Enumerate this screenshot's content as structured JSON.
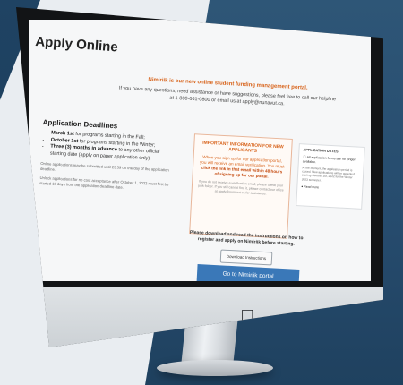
{
  "page": {
    "title": "Apply Online",
    "notice_headline": "Nimiriik is our new online student funding management portal.",
    "notice_body": "If you have any questions, need assistance or have suggestions, please feel free to call our helpline at 1-800-661-0800 or email us at apply@nunavut.ca."
  },
  "deadlines": {
    "heading": "Application Deadlines",
    "items": [
      {
        "bold": "March 1st",
        "rest": " for programs starting in the Fall;"
      },
      {
        "bold": "October 1st",
        "rest": " for programs starting in the Winter;"
      },
      {
        "bold": "Three (3) months in advance",
        "rest": " to any other official starting date (apply on paper application only)."
      }
    ],
    "note1": "Online applications may be submitted until 23:59 on the day of the application deadline.",
    "note2": "Unlock applications for no cost acceptance after October 1, 2022 must first be started 10 days from the application deadline date."
  },
  "info_box": {
    "title": "IMPORTANT INFORMATION FOR NEW APPLICANTS",
    "line1": "When you sign up for our application portal, you will receive an email verification. You must ",
    "line1_bold": "click the link in that email within 48 hours of signing up for our portal.",
    "small": "If you do not receive a verification email, please check your junk folder. If you still cannot find it, please contact our office at apply@nunavut.ca for assistance."
  },
  "app_dates": {
    "title": "APPLICATION DATES",
    "status": "All application forms are no longer available.",
    "text": "At the moment, the application period is closed. New applications will be accepted starting October 1st, 2022 for the Winter 2023 semester.",
    "read_more": "Read more"
  },
  "instructions": {
    "text": "Please download and read the instructions on how to register and apply on Nimiriik before starting.",
    "download_label": "Download Instructions"
  },
  "portal_button": "Go to Nimiriik portal"
}
